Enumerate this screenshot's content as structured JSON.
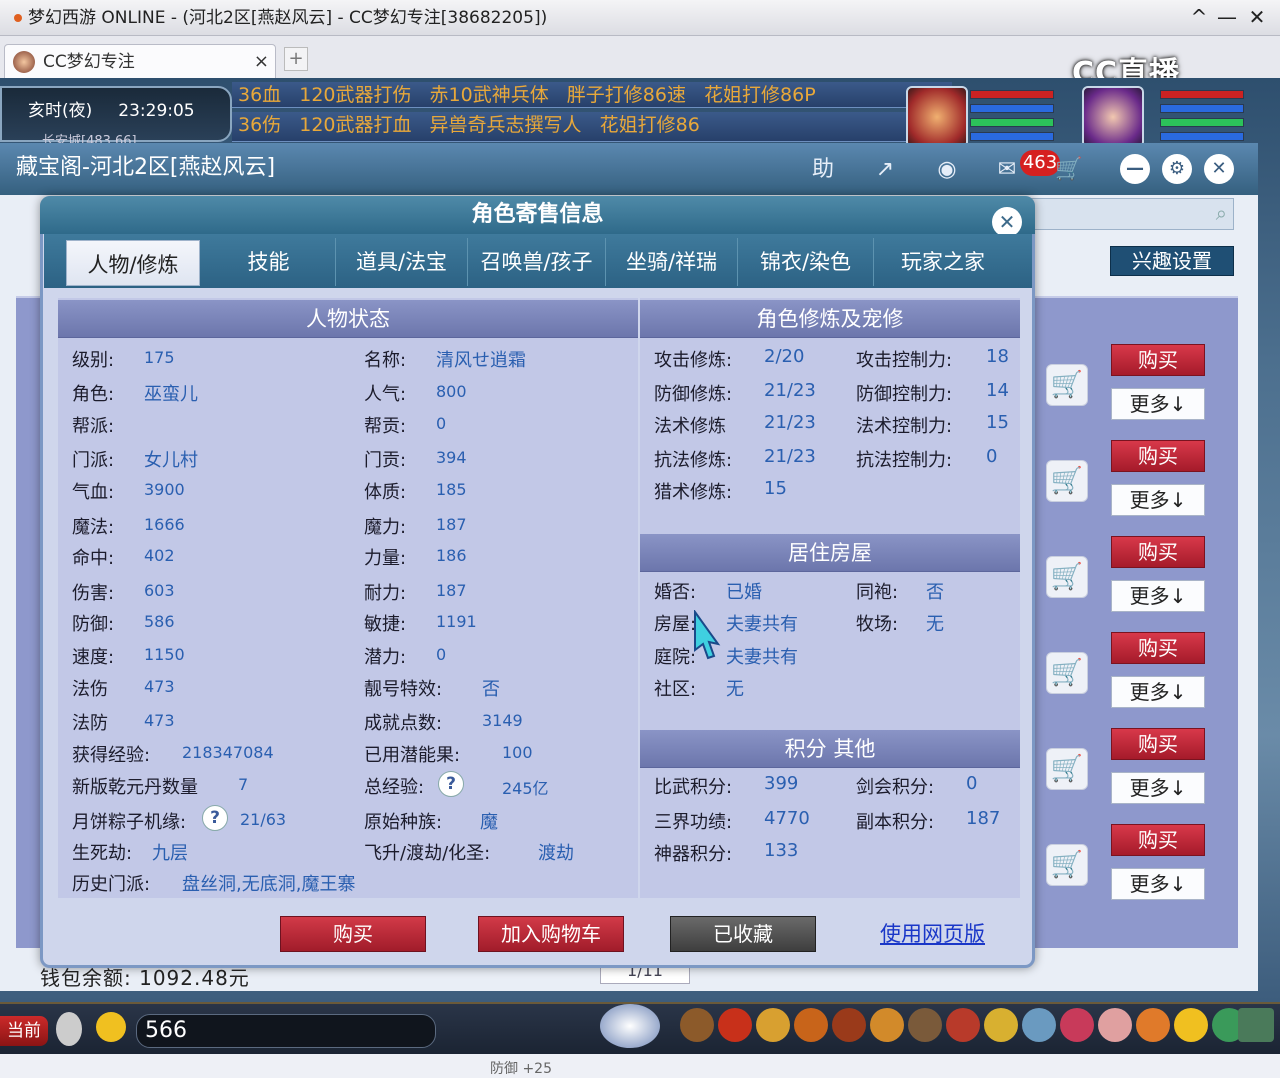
{
  "window": {
    "title": "梦幻西游 ONLINE - (河北2区[燕赵风云] - CC梦幻专注[38682205])",
    "controls": [
      "^",
      "—",
      "✕"
    ]
  },
  "browser_tab": {
    "label": "CC梦幻专注",
    "close": "×",
    "new_tab": "+"
  },
  "cc_logo": "CC直播",
  "game_hud": {
    "time_label": "亥时(夜)",
    "clock": "23:29:05",
    "location": "长安城[483,66]",
    "marquee_top": [
      "36血",
      "120武器打伤",
      "赤10武神兵体",
      "胖子打修86速",
      "花姐打修86P"
    ],
    "marquee_bottom": [
      "36伤",
      "120武器打血",
      "异兽奇兵志撰写人",
      "花姐打修86"
    ]
  },
  "store": {
    "title": "藏宝阁-河北2区[燕赵风云]",
    "help": "助",
    "message_count": "463",
    "interest_button": "兴趣设置",
    "wallet": "钱包余额: 1092.48元",
    "page": "1/11",
    "buy_label": "购买",
    "more_label": "更多↓",
    "rows": 6
  },
  "dialog": {
    "title": "角色寄售信息",
    "tabs": [
      "人物/修炼",
      "技能",
      "道具/法宝",
      "召唤兽/孩子",
      "坐骑/祥瑞",
      "锦衣/染色",
      "玩家之家"
    ],
    "status_header": "人物状态",
    "col1": [
      {
        "label": "级别:",
        "value": "175"
      },
      {
        "label": "角色:",
        "value": "巫蛮儿"
      },
      {
        "label": "帮派:",
        "value": ""
      },
      {
        "label": "门派:",
        "value": "女儿村"
      },
      {
        "label": "气血:",
        "value": "3900"
      },
      {
        "label": "魔法:",
        "value": "1666"
      },
      {
        "label": "命中:",
        "value": "402"
      },
      {
        "label": "伤害:",
        "value": "603"
      },
      {
        "label": "防御:",
        "value": "586"
      },
      {
        "label": "速度:",
        "value": "1150"
      },
      {
        "label": "法伤",
        "value": "473"
      },
      {
        "label": "法防",
        "value": "473"
      },
      {
        "label": "获得经验:",
        "value": "218347084"
      },
      {
        "label": "新版乾元丹数量",
        "value": "7"
      },
      {
        "label": "月饼粽子机缘:",
        "value": "21/63"
      },
      {
        "label": "生死劫:",
        "value": "九层"
      }
    ],
    "col2": [
      {
        "label": "名称:",
        "value": "清风せ逍霜"
      },
      {
        "label": "人气:",
        "value": "800"
      },
      {
        "label": "帮贡:",
        "value": "0"
      },
      {
        "label": "门贡:",
        "value": "394"
      },
      {
        "label": "体质:",
        "value": "185"
      },
      {
        "label": "魔力:",
        "value": "187"
      },
      {
        "label": "力量:",
        "value": "186"
      },
      {
        "label": "耐力:",
        "value": "187"
      },
      {
        "label": "敏捷:",
        "value": "1191"
      },
      {
        "label": "潜力:",
        "value": "0"
      },
      {
        "label": "靓号特效:",
        "value": "否"
      },
      {
        "label": "成就点数:",
        "value": "3149"
      },
      {
        "label": "已用潜能果:",
        "value": "100"
      },
      {
        "label": "总经验:",
        "value": "245亿"
      },
      {
        "label": "原始种族:",
        "value": "魔"
      },
      {
        "label": "飞升/渡劫/化圣:",
        "value": "渡劫"
      }
    ],
    "history": {
      "label": "历史门派:",
      "value": "盘丝洞,无底洞,魔王寨"
    },
    "cultivation_header": "角色修炼及宠修",
    "cultivation": [
      {
        "label": "攻击修炼:",
        "value": "2/20",
        "label2": "攻击控制力:",
        "value2": "18"
      },
      {
        "label": "防御修炼:",
        "value": "21/23",
        "label2": "防御控制力:",
        "value2": "14"
      },
      {
        "label": "法术修炼",
        "value": "21/23",
        "label2": "法术控制力:",
        "value2": "15"
      },
      {
        "label": "抗法修炼:",
        "value": "21/23",
        "label2": "抗法控制力:",
        "value2": "0"
      },
      {
        "label": "猎术修炼:",
        "value": "15",
        "label2": "",
        "value2": ""
      }
    ],
    "house_header": "居住房屋",
    "house": [
      {
        "label": "婚否:",
        "value": "已婚",
        "label2": "同袍:",
        "value2": "否"
      },
      {
        "label": "房屋:",
        "value": "夫妻共有",
        "label2": "牧场:",
        "value2": "无"
      },
      {
        "label": "庭院:",
        "value": "夫妻共有",
        "label2": "",
        "value2": ""
      },
      {
        "label": "社区:",
        "value": "无",
        "label2": "",
        "value2": ""
      }
    ],
    "score_header": "积分 其他",
    "scores": [
      {
        "label": "比武积分:",
        "value": "399",
        "label2": "剑会积分:",
        "value2": "0"
      },
      {
        "label": "三界功绩:",
        "value": "4770",
        "label2": "副本积分:",
        "value2": "187"
      },
      {
        "label": "神器积分:",
        "value": "133",
        "label2": "",
        "value2": ""
      }
    ],
    "actions": {
      "buy": "购买",
      "add_cart": "加入购物车",
      "favorited": "已收藏",
      "web": "使用网页版"
    }
  },
  "taskbar": {
    "channel": "当前",
    "chat_value": "566",
    "footnote": "防御 +25"
  },
  "colors": {
    "accent": "#2f6a8a",
    "buy": "#c22838",
    "value": "#2a5fb0",
    "panel": "#c2c8e7"
  }
}
